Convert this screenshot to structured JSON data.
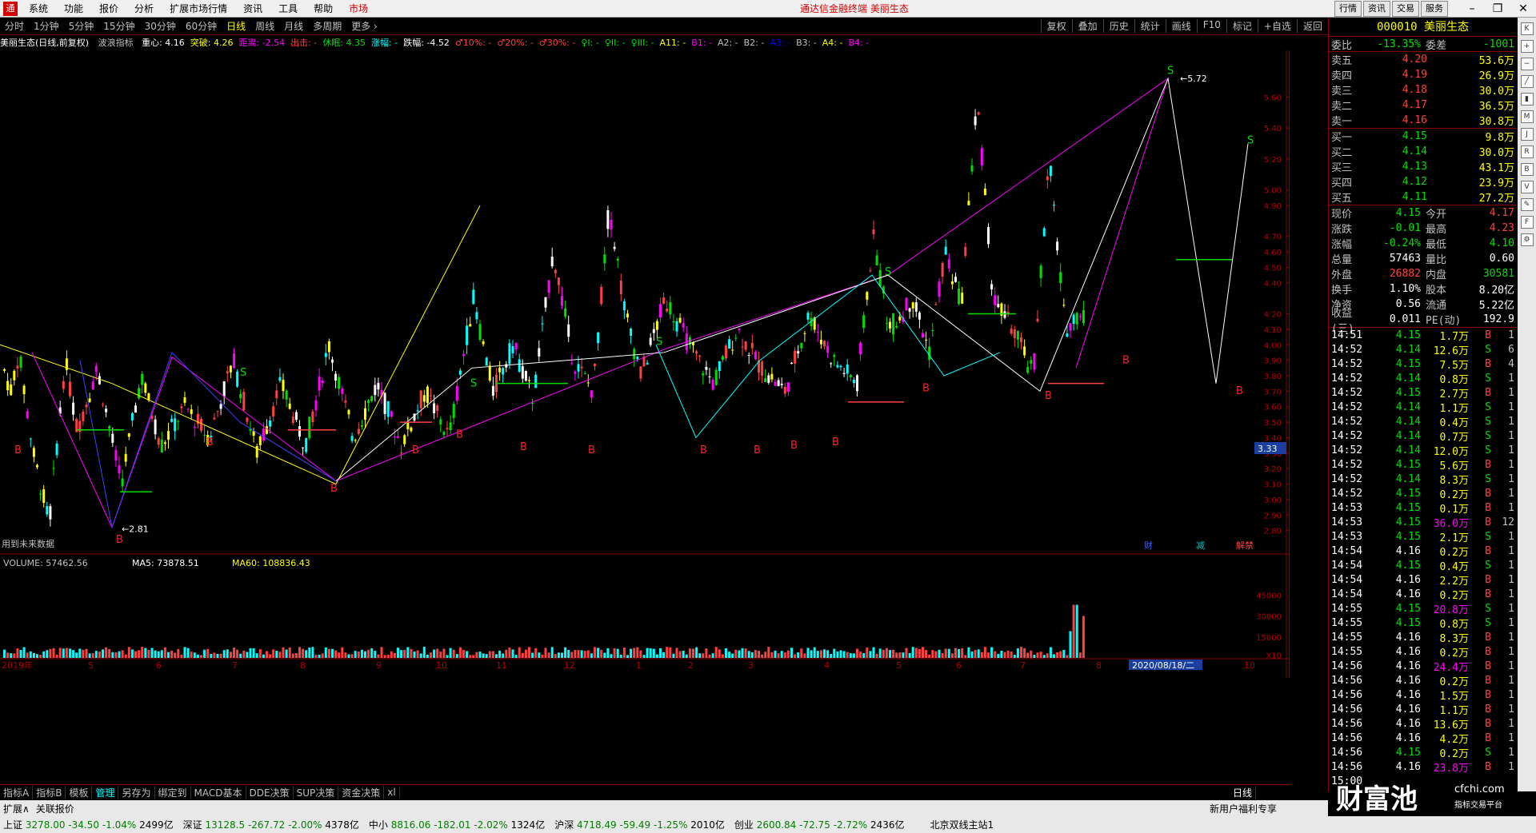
{
  "menubar": {
    "logo": "通",
    "items": [
      "系统",
      "功能",
      "报价",
      "分析",
      "扩展市场行情",
      "资讯",
      "工具",
      "帮助",
      "市场"
    ],
    "center_title": "通达信金融终端 美丽生态",
    "right_buttons": [
      "行情",
      "资讯",
      "交易",
      "服务"
    ]
  },
  "periods": {
    "items": [
      "分时",
      "1分钟",
      "5分钟",
      "15分钟",
      "30分钟",
      "60分钟",
      "日线",
      "周线",
      "月线",
      "多周期",
      "更多 ›"
    ],
    "selected": "日线",
    "right": [
      "复权",
      "叠加",
      "历史",
      "统计",
      "画线",
      "F10",
      "标记",
      "+自选",
      "返回"
    ]
  },
  "infoline": {
    "stock": "美丽生态(日线,前复权)",
    "indicator": "波浪指标",
    "parts": [
      {
        "t": "重心: 4.16",
        "c": "#ffffff"
      },
      {
        "t": "突破: 4.26",
        "c": "#ffff00"
      },
      {
        "t": "距离: -2.54",
        "c": "#ff00ff"
      },
      {
        "t": "出击: -",
        "c": "#ff4040"
      },
      {
        "t": "休眠: 4.35",
        "c": "#00e000"
      },
      {
        "t": "涨幅: -",
        "c": "#00ffff"
      },
      {
        "t": "跌幅: -4.52",
        "c": "#ffffff"
      },
      {
        "t": "♂10%: -",
        "c": "#ff4040"
      },
      {
        "t": "♂20%: -",
        "c": "#ff4040"
      },
      {
        "t": "♂30%: -",
        "c": "#ff4040"
      },
      {
        "t": "♀I: -",
        "c": "#00e000"
      },
      {
        "t": "♀II: -",
        "c": "#00e000"
      },
      {
        "t": "♀III: -",
        "c": "#00e000"
      },
      {
        "t": "A11: -",
        "c": "#ffff00"
      },
      {
        "t": "B1: -",
        "c": "#ff00ff"
      },
      {
        "t": "A2: -",
        "c": "#c0c0c0"
      },
      {
        "t": "B2: -",
        "c": "#c0c0c0"
      },
      {
        "t": "A3: -",
        "c": "#0000ff"
      },
      {
        "t": "B3: -",
        "c": "#c0c0c0"
      },
      {
        "t": "A4: -",
        "c": "#ffff00"
      },
      {
        "t": "B4: -",
        "c": "#ff00ff"
      }
    ]
  },
  "chart_data": {
    "type": "candlestick",
    "y_ticks": [
      "5.60",
      "5.40",
      "5.20",
      "5.00",
      "4.90",
      "4.70",
      "4.60",
      "4.50",
      "4.40",
      "4.20",
      "4.10",
      "4.00",
      "3.90",
      "3.80",
      "3.70",
      "3.60",
      "3.50",
      "3.40",
      "3.30",
      "3.20",
      "3.10",
      "3.00",
      "2.90",
      "2.80"
    ],
    "ylim": [
      2.7,
      5.85
    ],
    "x_ticks": [
      "2019年",
      "5",
      "6",
      "7",
      "8",
      "9",
      "10",
      "11",
      "12",
      "1",
      "2",
      "3",
      "4",
      "5",
      "6",
      "7",
      "8",
      "2020/08/18/二",
      "10"
    ],
    "current_price_label": "3.33",
    "high_label": "5.72",
    "low_label": "2.81",
    "footer_note": "用到未来数据",
    "marker_labels": [
      "财",
      "减",
      "解禁"
    ],
    "period_label": "日线",
    "volume": {
      "title": "VOLUME: 57462.56",
      "ma5": "MA5: 73878.51",
      "ma60": "MA60: 108836.43",
      "y_ticks": [
        "45000",
        "30000",
        "15000",
        "X10"
      ],
      "ylim": [
        0,
        60000
      ]
    }
  },
  "quote": {
    "code": "000010",
    "name": "美丽生态",
    "weibi": "-13.35%",
    "weicha": "-1001",
    "asks": [
      {
        "label": "卖五",
        "price": "4.20",
        "vol": "53.6万"
      },
      {
        "label": "卖四",
        "price": "4.19",
        "vol": "26.9万"
      },
      {
        "label": "卖三",
        "price": "4.18",
        "vol": "30.0万"
      },
      {
        "label": "卖二",
        "price": "4.17",
        "vol": "36.5万"
      },
      {
        "label": "卖一",
        "price": "4.16",
        "vol": "30.8万"
      }
    ],
    "bids": [
      {
        "label": "买一",
        "price": "4.15",
        "vol": "9.8万"
      },
      {
        "label": "买二",
        "price": "4.14",
        "vol": "30.0万"
      },
      {
        "label": "买三",
        "price": "4.13",
        "vol": "43.1万"
      },
      {
        "label": "买四",
        "price": "4.12",
        "vol": "23.9万"
      },
      {
        "label": "买五",
        "price": "4.11",
        "vol": "27.2万"
      }
    ],
    "stats": [
      [
        "现价",
        "4.15",
        "今开",
        "4.17"
      ],
      [
        "涨跌",
        "-0.01",
        "最高",
        "4.23"
      ],
      [
        "涨幅",
        "-0.24%",
        "最低",
        "4.10"
      ],
      [
        "总量",
        "57463",
        "量比",
        "0.60"
      ],
      [
        "外盘",
        "26882",
        "内盘",
        "30581"
      ],
      [
        "换手",
        "1.10%",
        "股本",
        "8.20亿"
      ],
      [
        "净资",
        "0.56",
        "流通",
        "5.22亿"
      ],
      [
        "收益(三)",
        "0.011",
        "PE(动)",
        "192.9"
      ]
    ],
    "ticks": [
      [
        "14:51",
        "4.15",
        "1.7万",
        "B",
        "1"
      ],
      [
        "14:52",
        "4.14",
        "12.6万",
        "S",
        "6"
      ],
      [
        "14:52",
        "4.15",
        "7.5万",
        "B",
        "4"
      ],
      [
        "14:52",
        "4.14",
        "0.8万",
        "S",
        "1"
      ],
      [
        "14:52",
        "4.15",
        "2.7万",
        "B",
        "1"
      ],
      [
        "14:52",
        "4.14",
        "1.1万",
        "S",
        "1"
      ],
      [
        "14:52",
        "4.14",
        "0.4万",
        "S",
        "1"
      ],
      [
        "14:52",
        "4.14",
        "0.7万",
        "S",
        "1"
      ],
      [
        "14:52",
        "4.14",
        "12.0万",
        "S",
        "1"
      ],
      [
        "14:52",
        "4.15",
        "5.6万",
        "B",
        "1"
      ],
      [
        "14:52",
        "4.14",
        "8.3万",
        "S",
        "1"
      ],
      [
        "14:52",
        "4.15",
        "0.2万",
        "B",
        "1"
      ],
      [
        "14:53",
        "4.15",
        "0.1万",
        "B",
        "1"
      ],
      [
        "14:53",
        "4.15",
        "36.0万",
        "B",
        "12"
      ],
      [
        "14:53",
        "4.15",
        "2.1万",
        "S",
        "1"
      ],
      [
        "14:54",
        "4.16",
        "0.2万",
        "B",
        "1"
      ],
      [
        "14:54",
        "4.15",
        "0.4万",
        "S",
        "1"
      ],
      [
        "14:54",
        "4.16",
        "2.2万",
        "B",
        "1"
      ],
      [
        "14:54",
        "4.16",
        "0.2万",
        "B",
        "1"
      ],
      [
        "14:55",
        "4.15",
        "20.8万",
        "S",
        "1"
      ],
      [
        "14:55",
        "4.15",
        "0.8万",
        "S",
        "1"
      ],
      [
        "14:55",
        "4.16",
        "8.3万",
        "B",
        "1"
      ],
      [
        "14:55",
        "4.16",
        "0.2万",
        "B",
        "1"
      ],
      [
        "14:56",
        "4.16",
        "24.4万",
        "B",
        "1"
      ],
      [
        "14:56",
        "4.16",
        "0.2万",
        "B",
        "1"
      ],
      [
        "14:56",
        "4.16",
        "1.5万",
        "B",
        "1"
      ],
      [
        "14:56",
        "4.16",
        "1.1万",
        "B",
        "1"
      ],
      [
        "14:56",
        "4.16",
        "13.6万",
        "B",
        "1"
      ],
      [
        "14:56",
        "4.16",
        "4.2万",
        "B",
        "1"
      ],
      [
        "14:56",
        "4.15",
        "0.2万",
        "S",
        "1"
      ],
      [
        "14:56",
        "4.16",
        "23.8万",
        "B",
        "1"
      ],
      [
        "15:00",
        "",
        "",
        "",
        ""
      ]
    ]
  },
  "bottomtabs": [
    "指标A",
    "指标B",
    "模板",
    "管理",
    "另存为",
    "绑定到",
    "MACD基本",
    "DDE决策",
    "SUP决策",
    "资金决策",
    "xl"
  ],
  "bottomtabs_selected": "管理",
  "tabs2": {
    "left": [
      "扩展∧",
      "关联报价"
    ],
    "promo": "新用户福利专享"
  },
  "status": [
    {
      "name": "上证",
      "price": "3278.00",
      "chg": "-34.50",
      "pct": "-1.04%",
      "amt": "2499亿"
    },
    {
      "name": "深证",
      "price": "13128.5",
      "chg": "-267.72",
      "pct": "-2.00%",
      "amt": "4378亿"
    },
    {
      "name": "中小",
      "price": "8816.06",
      "chg": "-182.01",
      "pct": "-2.02%",
      "amt": "1324亿"
    },
    {
      "name": "沪深",
      "price": "4718.49",
      "chg": "-59.49",
      "pct": "-1.25%",
      "amt": "2010亿"
    },
    {
      "name": "创业",
      "price": "2600.84",
      "chg": "-72.75",
      "pct": "-2.72%",
      "amt": "2436亿"
    }
  ],
  "status_right": "北京双线主站1",
  "watermark": {
    "big": "财富池",
    "site": "cfchi.com",
    "small": "指标交易平台"
  },
  "colors": {
    "up": "#ff4040",
    "down": "#00e000",
    "axis": "#8b0000",
    "bg": "#000000"
  }
}
